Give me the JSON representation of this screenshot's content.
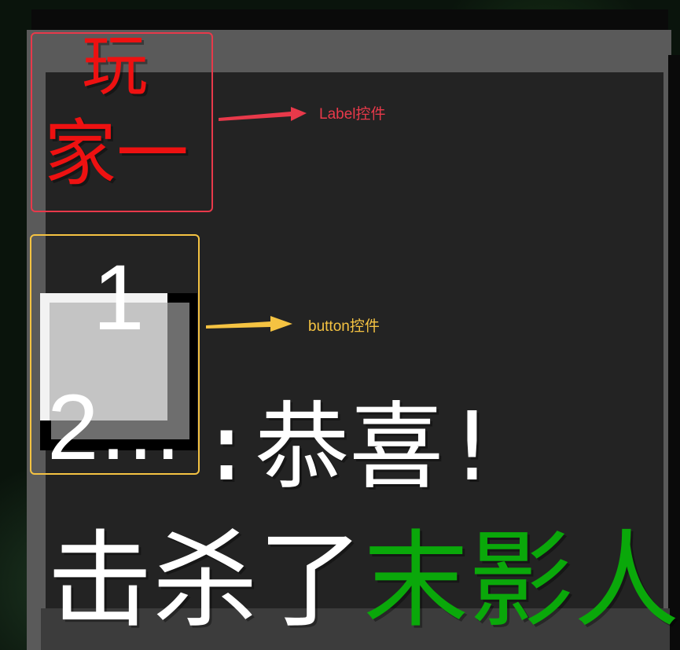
{
  "label_widget": {
    "text_line1": "玩",
    "text_line2": "家一",
    "color": "#ee1111"
  },
  "button_widget": {
    "text_line1": "1",
    "text_line2": "2..."
  },
  "message": {
    "line1": ":恭喜!",
    "line2_prefix": "击杀了",
    "line2_name": "末影人",
    "text_color": "#ffffff",
    "name_color": "#0aa80a"
  },
  "annotations": {
    "label_note": "Label控件",
    "label_color": "#e8394a",
    "button_note": "button控件",
    "button_color": "#f5c342"
  }
}
